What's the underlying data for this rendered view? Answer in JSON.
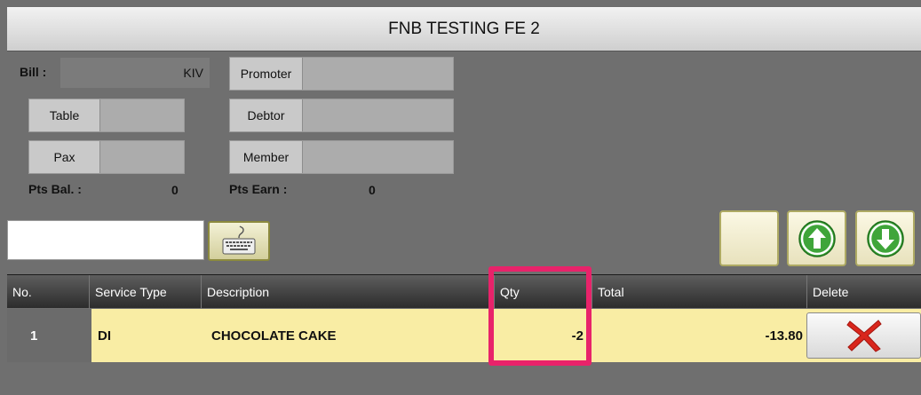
{
  "window": {
    "title": "FNB TESTING FE 2"
  },
  "bill": {
    "label": "Bill :",
    "value": "KIV"
  },
  "fields": {
    "table": {
      "label": "Table",
      "value": ""
    },
    "pax": {
      "label": "Pax",
      "value": ""
    },
    "promoter": {
      "label": "Promoter",
      "value": ""
    },
    "debtor": {
      "label": "Debtor",
      "value": ""
    },
    "member": {
      "label": "Member",
      "value": ""
    }
  },
  "points": {
    "balance_label": "Pts Bal. :",
    "balance_value": "0",
    "earn_label": "Pts Earn :",
    "earn_value": "0"
  },
  "search": {
    "value": "",
    "placeholder": ""
  },
  "icons": {
    "keyboard": "keyboard-icon",
    "up": "arrow-up-icon",
    "down": "arrow-down-icon",
    "delete": "close-icon"
  },
  "colors": {
    "row_highlight": "#f9eda4",
    "selection_frame": "#e8236a",
    "arrow_green": "#3fa53a",
    "delete_red": "#d9261c"
  },
  "table": {
    "columns": [
      "No.",
      "Service Type",
      "Description",
      "Qty",
      "Total",
      "Delete"
    ],
    "rows": [
      {
        "no": "1",
        "service_type": "DI",
        "description": "CHOCOLATE CAKE",
        "qty": "-2",
        "total": "-13.80"
      }
    ]
  }
}
